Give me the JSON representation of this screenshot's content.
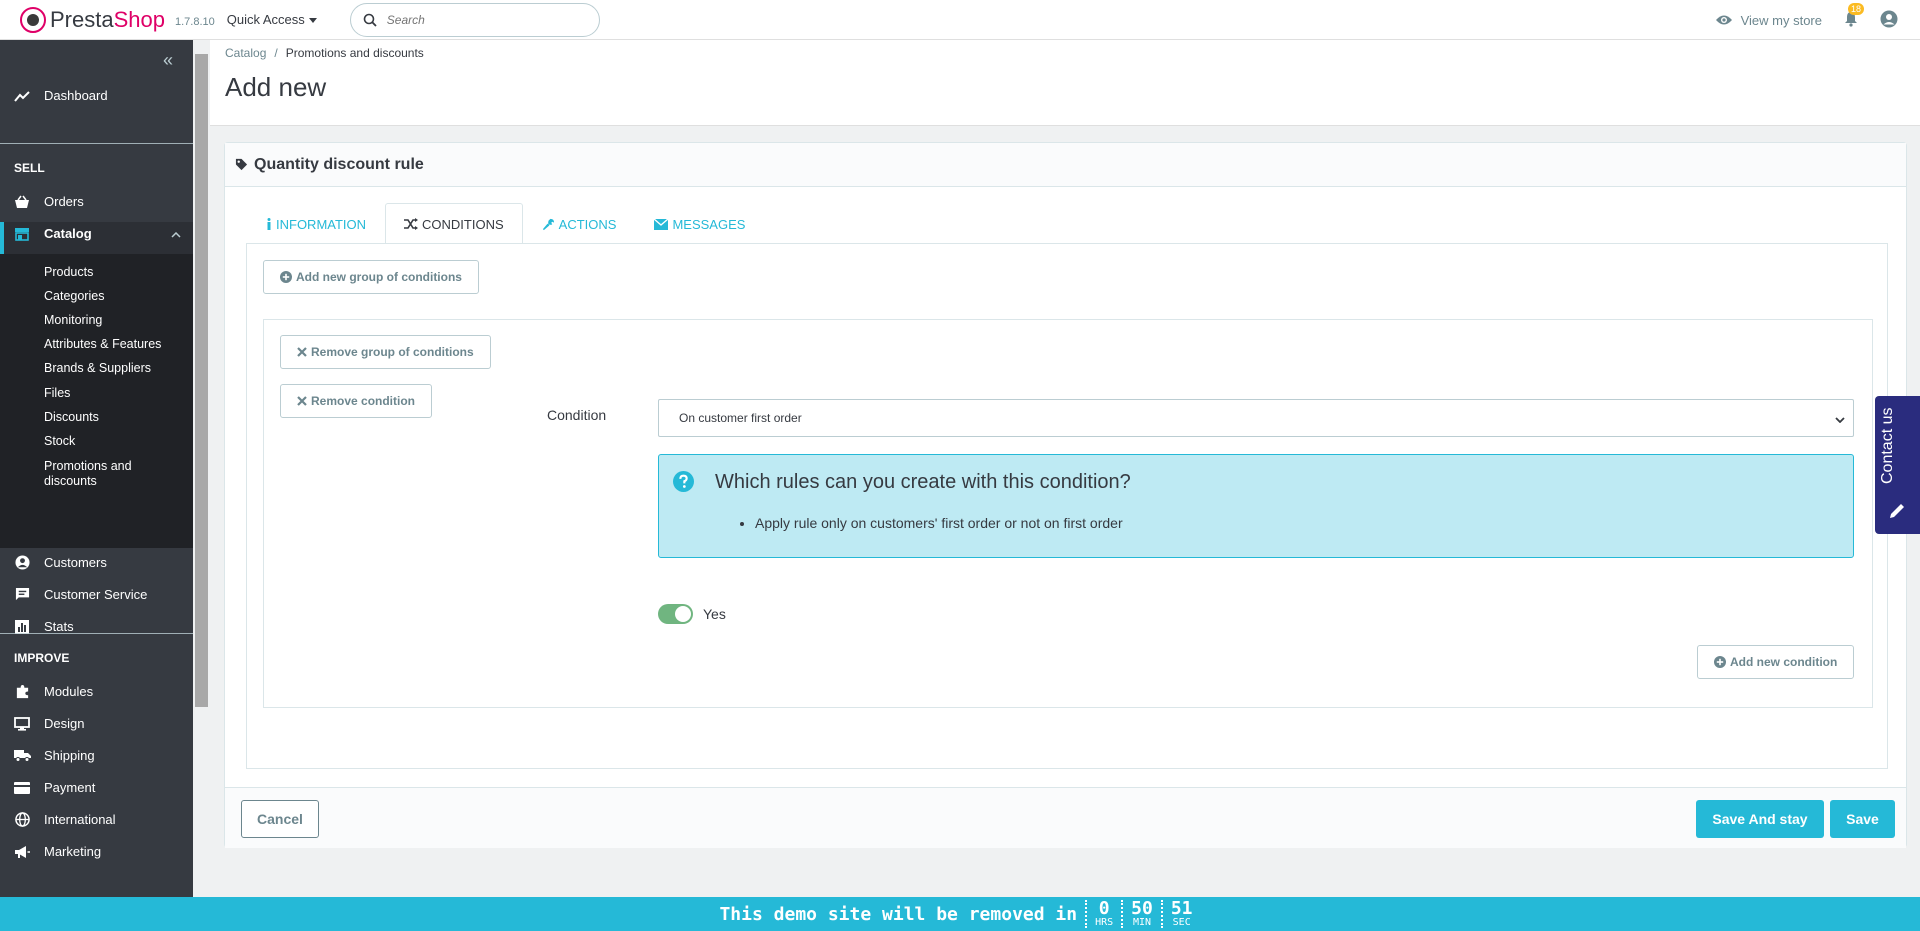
{
  "header": {
    "brand_part1": "Presta",
    "brand_part2": "Shop",
    "version": "1.7.8.10",
    "quick_access": "Quick Access",
    "search_placeholder": "Search",
    "view_store": "View my store",
    "notifications_count": "18"
  },
  "sidebar": {
    "dashboard": "Dashboard",
    "section_sell": "SELL",
    "orders": "Orders",
    "catalog": "Catalog",
    "catalog_sub": [
      "Products",
      "Categories",
      "Monitoring",
      "Attributes & Features",
      "Brands & Suppliers",
      "Files",
      "Discounts",
      "Stock",
      "Promotions and",
      "discounts"
    ],
    "customers": "Customers",
    "customer_service": "Customer Service",
    "stats": "Stats",
    "section_improve": "IMPROVE",
    "modules": "Modules",
    "design": "Design",
    "shipping": "Shipping",
    "payment": "Payment",
    "international": "International",
    "marketing": "Marketing"
  },
  "breadcrumb": {
    "parent": "Catalog",
    "separator": "/",
    "current": "Promotions and discounts"
  },
  "page_title": "Add new",
  "panel": {
    "title": "Quantity discount rule",
    "tabs": [
      {
        "label": "INFORMATION",
        "icon": "info-icon"
      },
      {
        "label": "CONDITIONS",
        "icon": "shuffle-icon"
      },
      {
        "label": "ACTIONS",
        "icon": "wrench-icon"
      },
      {
        "label": "MESSAGES",
        "icon": "envelope-icon"
      }
    ],
    "active_tab": "CONDITIONS",
    "add_group_label": "Add new group of conditions",
    "remove_group_label": "Remove group of conditions",
    "remove_condition_label": "Remove condition",
    "condition_label": "Condition",
    "condition_value": "On customer first order",
    "info_title": "Which rules can you create with this condition?",
    "info_items": [
      "Apply rule only on customers' first order or not on first order"
    ],
    "toggle_label": "Yes",
    "toggle_on": true,
    "add_condition_label": "Add new condition",
    "cancel_label": "Cancel",
    "save_stay_label": "Save And stay",
    "save_label": "Save"
  },
  "contact": {
    "label": "Contact us"
  },
  "demo_banner": {
    "text": "This demo site will be removed in",
    "hours": "0",
    "hours_label": "HRS",
    "minutes": "50",
    "minutes_label": "MIN",
    "seconds": "51",
    "seconds_label": "SEC"
  },
  "colors": {
    "accent": "#25b9d7",
    "brand_pink": "#df0067",
    "sidebar_bg": "#363a41",
    "toggle_on": "#70b580",
    "info_bg": "#beeaf3",
    "contact_bg": "#2a2c7e"
  }
}
